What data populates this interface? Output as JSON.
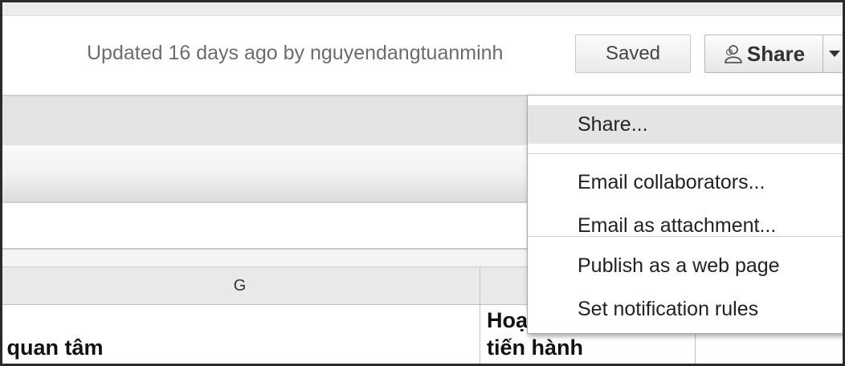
{
  "header": {
    "updated_text": "Updated 16 days ago by nguyendangtuanminh",
    "saved_label": "Saved",
    "share_label": "Share"
  },
  "sheet": {
    "column_g_header": "G",
    "cell_g_text": "ề quan tâm",
    "cell_h_line1": "Hoạ",
    "cell_h_line2": "tiến hành"
  },
  "share_menu": {
    "items": [
      {
        "label": "Share..."
      },
      {
        "label": "Email collaborators..."
      },
      {
        "label": "Email as attachment..."
      },
      {
        "label": "Publish as a web page"
      },
      {
        "label": "Set notification rules"
      }
    ],
    "highlighted_item": "Share..."
  },
  "icons": {
    "share_button_icon": "people-icon",
    "dropdown_icon": "chevron-down-icon"
  }
}
